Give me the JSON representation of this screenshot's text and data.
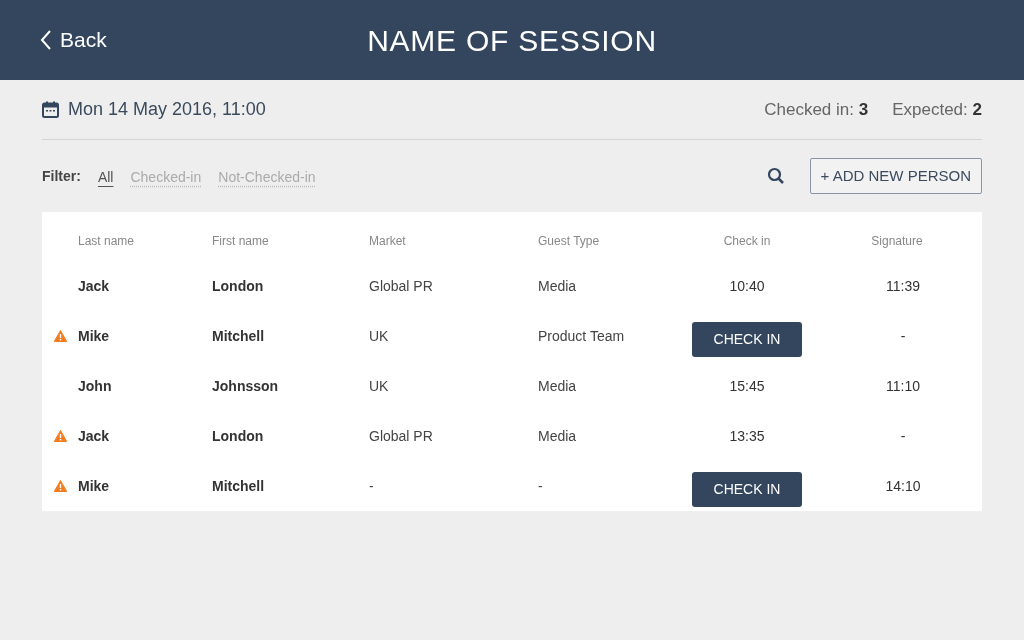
{
  "header": {
    "back": "Back",
    "title": "NAME OF SESSION"
  },
  "session": {
    "date": "Mon 14 May 2016, 11:00",
    "stats": [
      {
        "label": "Checked in:",
        "value": "3"
      },
      {
        "label": "Expected:",
        "value": "2"
      }
    ]
  },
  "filter": {
    "label": "Filter:",
    "options": [
      {
        "label": "All",
        "selected": true
      },
      {
        "label": "Checked-in",
        "selected": false
      },
      {
        "label": "Not-Checked-in",
        "selected": false
      }
    ]
  },
  "add_button": "+ ADD NEW PERSON",
  "table": {
    "columns": [
      "Last name",
      "First name",
      "Market",
      "Guest Type",
      "Check in",
      "Signature"
    ],
    "rows": [
      {
        "warning": false,
        "last_name": "Jack",
        "first_name": "London",
        "market": "Global PR",
        "guest_type": "Media",
        "check_in": {
          "kind": "time",
          "text": "10:40"
        },
        "signature": "11:39"
      },
      {
        "warning": true,
        "last_name": "Mike",
        "first_name": "Mitchell",
        "market": "UK",
        "guest_type": "Product Team",
        "check_in": {
          "kind": "button",
          "text": "CHECK IN"
        },
        "signature": "-"
      },
      {
        "warning": false,
        "last_name": "John",
        "first_name": "Johnsson",
        "market": "UK",
        "guest_type": "Media",
        "check_in": {
          "kind": "time",
          "text": "15:45"
        },
        "signature": "11:10"
      },
      {
        "warning": true,
        "last_name": "Jack",
        "first_name": "London",
        "market": "Global PR",
        "guest_type": "Media",
        "check_in": {
          "kind": "time",
          "text": "13:35"
        },
        "signature": "-"
      },
      {
        "warning": true,
        "last_name": "Mike",
        "first_name": "Mitchell",
        "market": "-",
        "guest_type": "-",
        "check_in": {
          "kind": "button",
          "text": "CHECK IN"
        },
        "signature": "14:10"
      }
    ]
  }
}
